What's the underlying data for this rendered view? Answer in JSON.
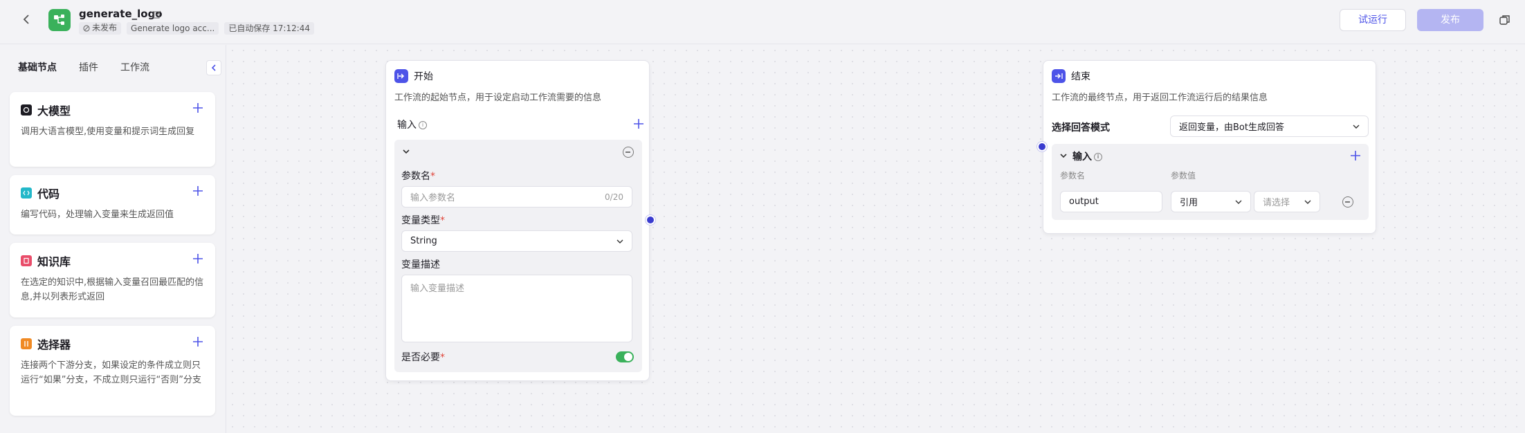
{
  "app": {
    "title": "generate_logo",
    "status": "未发布",
    "description": "Generate logo acc...",
    "autosave": "已自动保存 17:12:44",
    "test_run_label": "试运行",
    "publish_label": "发布"
  },
  "sidebar": {
    "tabs": [
      {
        "label": "基础节点",
        "active": true
      },
      {
        "label": "插件",
        "active": false
      },
      {
        "label": "工作流",
        "active": false
      }
    ],
    "cards": [
      {
        "title": "大模型",
        "desc": "调用大语言模型,使用变量和提示词生成回复",
        "icon": "llm-icon",
        "color": "#1d1c23"
      },
      {
        "title": "代码",
        "desc": "编写代码，处理输入变量来生成返回值",
        "icon": "code-icon",
        "color": "#23b8c9"
      },
      {
        "title": "知识库",
        "desc": "在选定的知识中,根据输入变量召回最匹配的信息,并以列表形式返回",
        "icon": "knowledge-icon",
        "color": "#e94d6a"
      },
      {
        "title": "选择器",
        "desc": "连接两个下游分支，如果设定的条件成立则只运行“如果”分支，不成立则只运行“否则”分支",
        "icon": "selector-icon",
        "color": "#f08a24"
      }
    ]
  },
  "start_node": {
    "title": "开始",
    "desc": "工作流的起始节点，用于设定启动工作流需要的信息",
    "input_label": "输入",
    "param_name_label": "参数名",
    "param_name_placeholder": "输入参数名",
    "param_name_counter": "0/20",
    "var_type_label": "变量类型",
    "var_type_value": "String",
    "var_desc_label": "变量描述",
    "var_desc_placeholder": "输入变量描述",
    "required_label": "是否必要",
    "required_on": true
  },
  "end_node": {
    "title": "结束",
    "desc": "工作流的最终节点，用于返回工作流运行后的结果信息",
    "mode_label": "选择回答模式",
    "mode_value": "返回变量，由Bot生成回答",
    "input_label": "输入",
    "col_param_name": "参数名",
    "col_param_value": "参数值",
    "row_name": "output",
    "row_type": "引用",
    "row_select": "请选择"
  },
  "colors": {
    "accent": "#4d53e8",
    "brand_green": "#3ab15b",
    "connector": "#3a3ccf"
  }
}
